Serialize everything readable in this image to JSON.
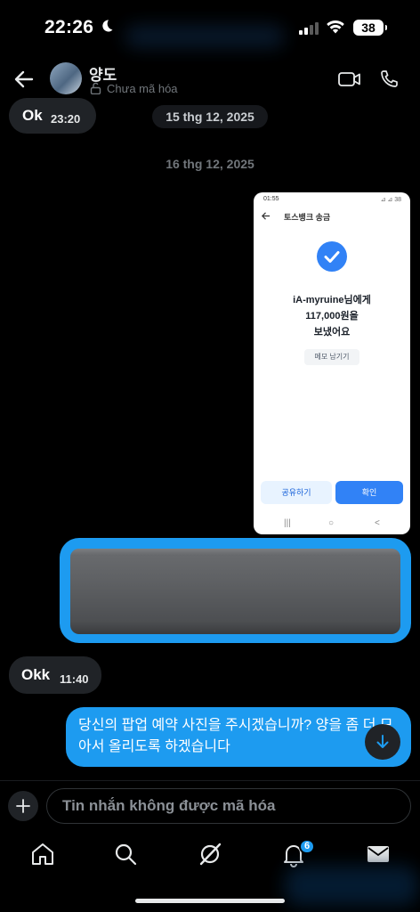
{
  "status_bar": {
    "time": "22:26",
    "battery": "38"
  },
  "header": {
    "contact_name": "양도",
    "encryption_status": "Chưa mã hóa"
  },
  "messages": {
    "ok": {
      "text": "Ok",
      "time": "23:20"
    },
    "date_pill": "15 thg 12, 2025",
    "date_label": "16 thg 12, 2025",
    "screenshot": {
      "status_time": "01:55",
      "status_icons": "⊿ ⊿ 38",
      "title": "토스뱅크 송금",
      "line1": "iA-myruine님에게",
      "line2": "117,000원을",
      "line3": "보냈어요",
      "memo_button": "메모 남기기",
      "share_button": "공유하기",
      "confirm_button": "확인",
      "nav_recent": "|||",
      "nav_home": "○",
      "nav_back": "<"
    },
    "okk": {
      "text": "Okk",
      "time": "11:40"
    },
    "sent_text": "당신의 팝업 예약 사진을 주시겠습니까? 양을 좀 더 모아서 올리도록 하겠습니다"
  },
  "composer": {
    "placeholder": "Tin nhắn không được mã hóa"
  },
  "tabbar": {
    "notifications_badge": "6"
  },
  "colors": {
    "accent": "#1d9bf0",
    "background": "#000000",
    "bubble_gray": "#202327",
    "toss_blue": "#3182f6"
  }
}
